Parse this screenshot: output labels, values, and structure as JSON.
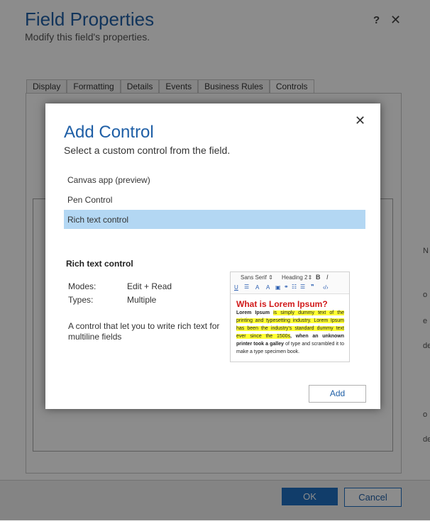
{
  "dialog": {
    "title": "Field Properties",
    "subtitle": "Modify this field's properties.",
    "help_label": "?",
    "close_label": "✕",
    "tabs": [
      {
        "label": "Display"
      },
      {
        "label": "Formatting"
      },
      {
        "label": "Details"
      },
      {
        "label": "Events"
      },
      {
        "label": "Business Rules"
      },
      {
        "label": "Controls"
      }
    ],
    "active_tab": "Controls",
    "ok_label": "OK",
    "cancel_label": "Cancel",
    "edge_fragments": [
      "N",
      "o",
      "e",
      "de",
      "o",
      "de"
    ]
  },
  "add_control": {
    "title": "Add Control",
    "subtitle": "Select a custom control from the field.",
    "close_label": "✕",
    "options": [
      {
        "label": "Canvas app (preview)",
        "selected": false
      },
      {
        "label": "Pen Control",
        "selected": false
      },
      {
        "label": "Rich text control",
        "selected": true
      }
    ],
    "details": {
      "name": "Rich text control",
      "modes_label": "Modes:",
      "modes_value": "Edit + Read",
      "types_label": "Types:",
      "types_value": "Multiple",
      "description": "A control that let you to write rich text for multiline fields"
    },
    "preview": {
      "font_select": "Sans Serif ⇕",
      "heading_select": "Heading 2⇕",
      "heading": "What is Lorem Ipsum?",
      "body_bold": "Lorem Ipsum",
      "body_highlight": "is simply dummy text of the printing and typesetting industry. Lorem Ipsum has been the industry's standard dummy text ever since the 1500s",
      "body_bold2": ", when an unknown printer took a galley",
      "body_tail": "of type and scrambled it to make a type specimen book."
    },
    "add_label": "Add"
  },
  "colors": {
    "accent": "#1f5fa6",
    "selected_row": "#b3d7f3",
    "ok_button": "#1f6fc2",
    "highlight": "#ffff33",
    "heading_red": "#d11a1a"
  }
}
